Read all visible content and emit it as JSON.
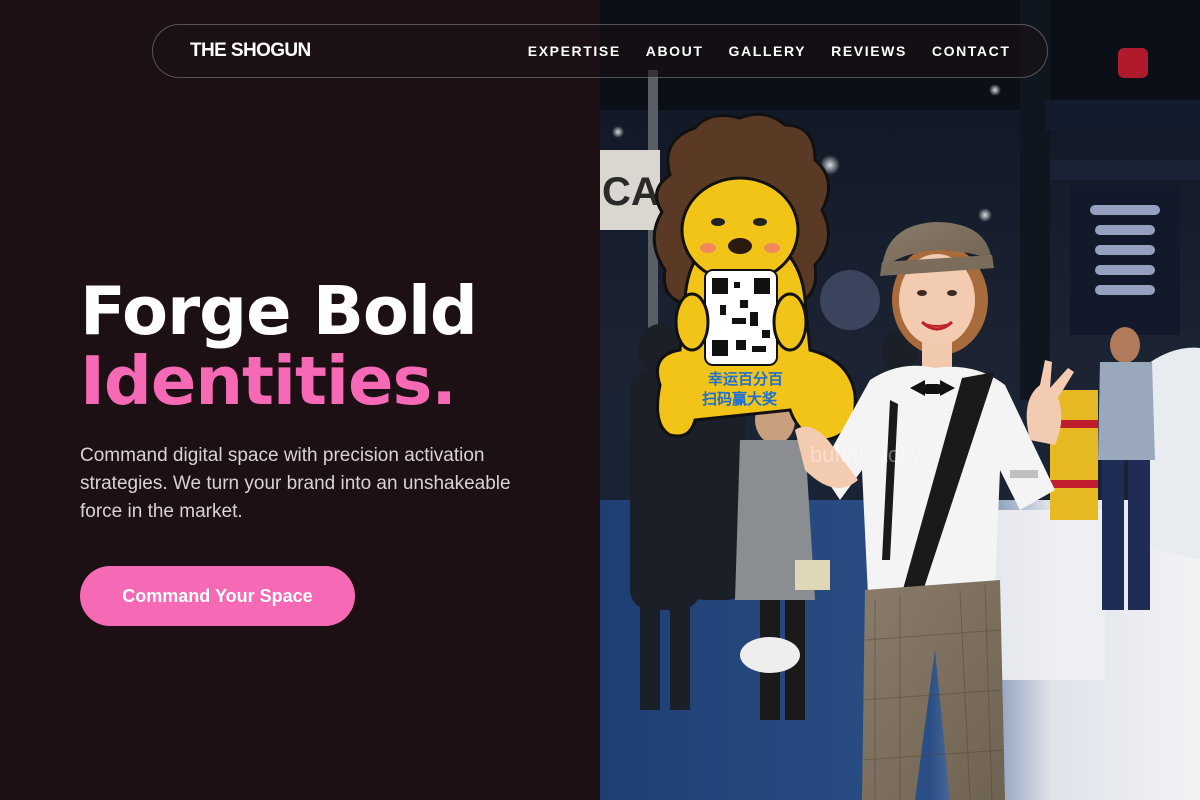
{
  "brand": {
    "name": "THE SHOGUN"
  },
  "nav": {
    "links": [
      {
        "label": "EXPERTISE"
      },
      {
        "label": "ABOUT"
      },
      {
        "label": "GALLERY"
      },
      {
        "label": "REVIEWS"
      },
      {
        "label": "CONTACT"
      }
    ]
  },
  "hero": {
    "heading_line_1": "Forge Bold",
    "heading_line_2": "Identities.",
    "subtitle": "Command digital space with precision activation strategies. We turn your brand into an unshakeable force in the market.",
    "cta_label": "Command Your Space"
  },
  "photo": {
    "sign_text_line_1": "幸运百分百",
    "sign_text_line_2": "扫码赢大奖",
    "watermark": "buffalo.tokyo"
  },
  "colors": {
    "background": "#1c1014",
    "accent_pink": "#f669b4",
    "text_white": "#ffffff",
    "text_muted": "#d9d2d6"
  }
}
